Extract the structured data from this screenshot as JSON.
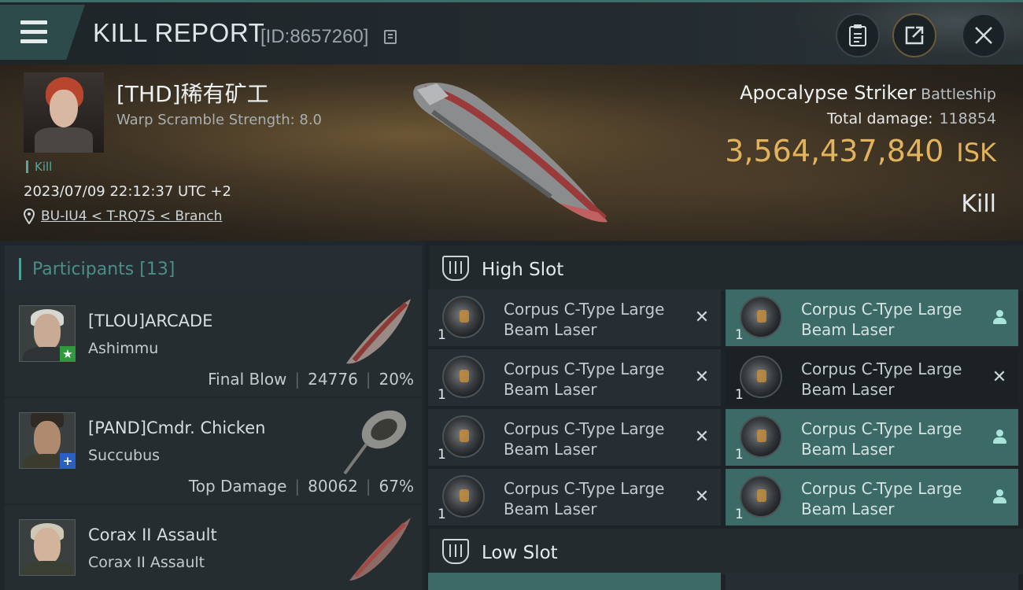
{
  "header": {
    "title": "KILL REPORT",
    "id_label": "[ID:8657260]"
  },
  "victim": {
    "name": "[THD]稀有矿工",
    "warp_scramble": "Warp Scramble Strength: 8.0",
    "status_tag": "Kill",
    "timestamp": "2023/07/09 22:12:37 UTC +2",
    "location": "BU-IU4 < T-RQ7S < Branch",
    "ship_name": "Apocalypse Striker",
    "ship_class": "Battleship",
    "total_damage_label": "Total damage:",
    "total_damage_value": "118854",
    "isk_value": "3,564,437,840",
    "isk_unit": "ISK",
    "result": "Kill"
  },
  "participants": {
    "label": "Participants",
    "count": "[13]",
    "rows": [
      {
        "name": "[TLOU]ARCADE",
        "ship": "Ashimmu",
        "role": "Final Blow",
        "damage": "24776",
        "percent": "20%",
        "badge": "★",
        "badge_color": "#2f9a3d"
      },
      {
        "name": "[PAND]Cmdr. Chicken",
        "ship": "Succubus",
        "role": "Top Damage",
        "damage": "80062",
        "percent": "67%",
        "badge": "+",
        "badge_color": "#2b5fc4"
      },
      {
        "name": "Corax II Assault",
        "ship": "Corax II Assault",
        "role": "",
        "damage": "",
        "percent": "",
        "badge": "",
        "badge_color": ""
      }
    ]
  },
  "fitting": {
    "high_slot_label": "High Slot",
    "low_slot_label": "Low Slot",
    "high_modules": [
      {
        "name": "Corpus C-Type Large Beam Laser",
        "qty": "1",
        "state": "destroyed"
      },
      {
        "name": "Corpus C-Type Large Beam Laser",
        "qty": "1",
        "state": "dropped"
      },
      {
        "name": "Corpus C-Type Large Beam Laser",
        "qty": "1",
        "state": "destroyed"
      },
      {
        "name": "Corpus C-Type Large Beam Laser",
        "qty": "1",
        "state": "destroyed"
      },
      {
        "name": "Corpus C-Type Large Beam Laser",
        "qty": "1",
        "state": "destroyed"
      },
      {
        "name": "Corpus C-Type Large Beam Laser",
        "qty": "1",
        "state": "dropped"
      },
      {
        "name": "Corpus C-Type Large Beam Laser",
        "qty": "1",
        "state": "destroyed"
      },
      {
        "name": "Corpus C-Type Large Beam Laser",
        "qty": "1",
        "state": "dropped"
      }
    ]
  },
  "colors": {
    "accent_teal": "#4fa197",
    "isk_gold": "#e2b35c",
    "dropped_bg": "#3b6a67"
  }
}
